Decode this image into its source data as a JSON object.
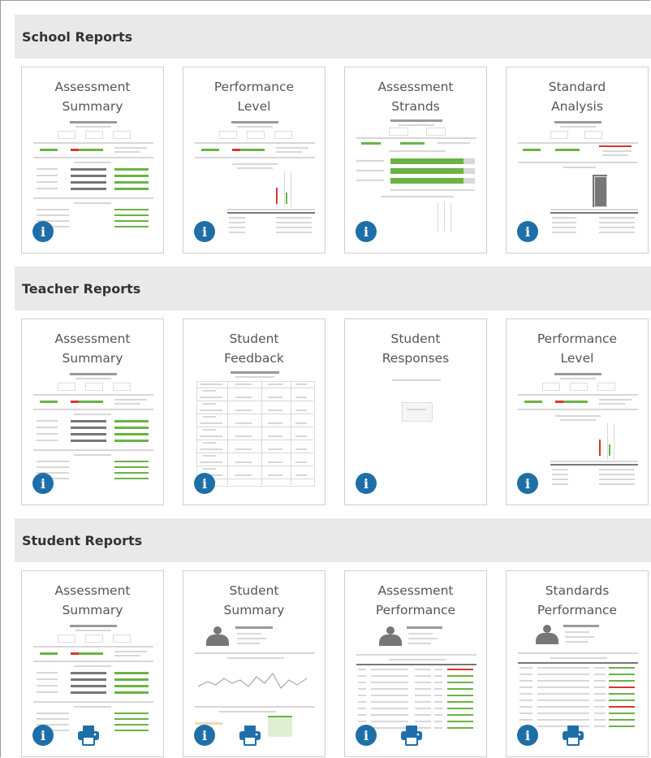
{
  "sections": [
    {
      "title": "School Reports",
      "cards": [
        {
          "title": "Assessment Summary",
          "thumb": "summary",
          "print": false
        },
        {
          "title": "Performance Level",
          "thumb": "perf-level",
          "print": false
        },
        {
          "title": "Assessment Strands",
          "thumb": "strands",
          "print": false
        },
        {
          "title": "Standard Analysis",
          "thumb": "standard",
          "print": false
        }
      ]
    },
    {
      "title": "Teacher Reports",
      "cards": [
        {
          "title": "Assessment Summary",
          "thumb": "summary",
          "print": false
        },
        {
          "title": "Student Feedback",
          "thumb": "feedback",
          "print": false
        },
        {
          "title": "Student Responses",
          "thumb": "responses",
          "print": false
        },
        {
          "title": "Performance Level",
          "thumb": "perf-level",
          "print": false
        }
      ]
    },
    {
      "title": "Student Reports",
      "cards": [
        {
          "title": "Assessment Summary",
          "thumb": "summary",
          "print": true
        },
        {
          "title": "Student Summary",
          "thumb": "student-summary",
          "print": true
        },
        {
          "title": "Assessment Performance",
          "thumb": "assess-perf",
          "print": true
        },
        {
          "title": "Standards Performance",
          "thumb": "standards-perf",
          "print": true
        }
      ]
    }
  ],
  "icons": {
    "info": "info-icon",
    "print": "print-icon"
  },
  "colors": {
    "accent": "#1e6fa8",
    "header_bg": "#e9e9e9",
    "bar_green": "#6ab344",
    "bar_red": "#dd3333"
  }
}
